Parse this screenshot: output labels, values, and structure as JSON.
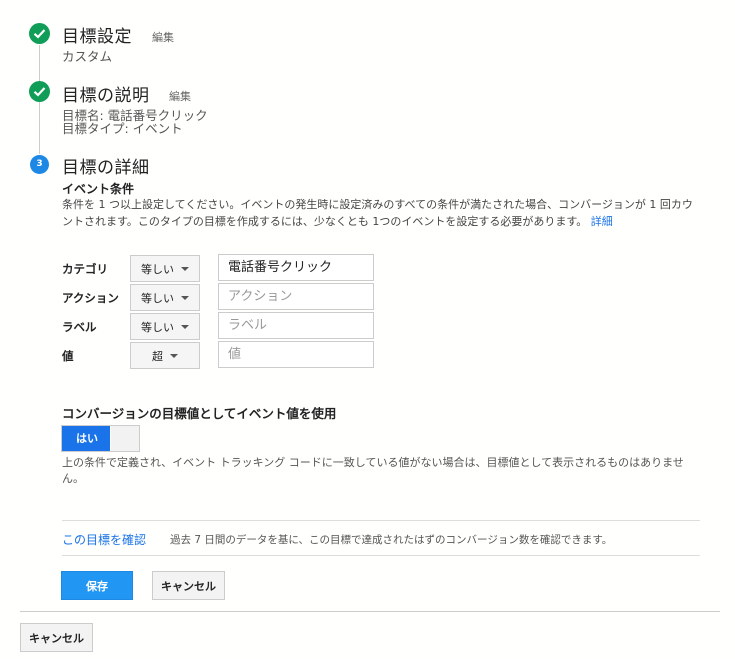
{
  "steps": [
    {
      "title": "目標設定",
      "edit": "編集",
      "sub": [
        "カスタム"
      ]
    },
    {
      "title": "目標の説明",
      "edit": "編集",
      "sub": [
        "目標名: 電話番号クリック",
        "目標タイプ: イベント"
      ]
    },
    {
      "number": "3",
      "title": "目標の詳細"
    }
  ],
  "event_conditions": {
    "title": "イベント条件",
    "description": "条件を 1 つ以上設定してください。イベントの発生時に設定済みのすべての条件が満たされた場合、コンバージョンが 1 回カウントされます。このタイプの目標を作成するには、少なくとも 1つのイベントを設定する必要があります。",
    "details_link": "詳細",
    "rows": [
      {
        "label": "カテゴリ",
        "operator": "等しい",
        "value": "電話番号クリック",
        "placeholder": ""
      },
      {
        "label": "アクション",
        "operator": "等しい",
        "value": "",
        "placeholder": "アクション"
      },
      {
        "label": "ラベル",
        "operator": "等しい",
        "value": "",
        "placeholder": "ラベル"
      },
      {
        "label": "値",
        "operator": "超",
        "value": "",
        "placeholder": "値"
      }
    ]
  },
  "use_event_value": {
    "title": "コンバージョンの目標値としてイベント値を使用",
    "toggle_label": "はい",
    "toggle_on": true,
    "note": "上の条件で定義され、イベント トラッキング コードに一致している値がない場合は、目標値として表示されるものはありません。"
  },
  "verify": {
    "link": "この目標を確認",
    "note": "過去 7 日間のデータを基に、この目標で達成されたはずのコンバージョン数を確認できます。"
  },
  "buttons": {
    "save": "保存",
    "cancel": "キャンセル",
    "cancel_bottom": "キャンセル"
  },
  "colors": {
    "check_green": "#0f9d58",
    "step_blue": "#1e88e5",
    "primary_blue": "#2196f3",
    "link_blue": "#1a73e8"
  }
}
